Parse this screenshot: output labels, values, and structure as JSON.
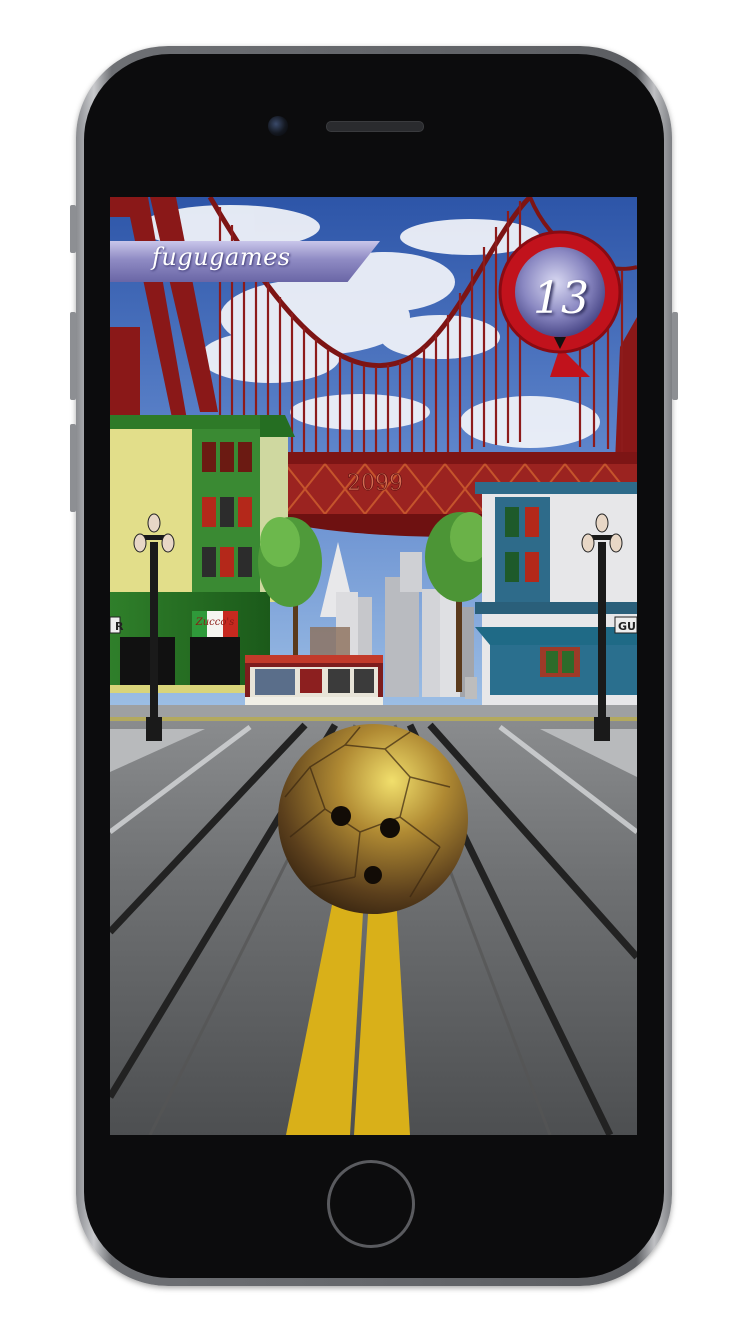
{
  "game": {
    "player_name": "fugugames",
    "pins_remaining": "13",
    "bridge_year": "2099",
    "shop_sign": "Zucco's",
    "left_street_sign": "R",
    "right_street_sign": "GU"
  },
  "colors": {
    "sky": "#3a63b6",
    "bridge": "#8d1b1b",
    "lane_yellow": "#d9b019",
    "badge_red": "#c1121c",
    "banner": "#8f8bc4"
  }
}
